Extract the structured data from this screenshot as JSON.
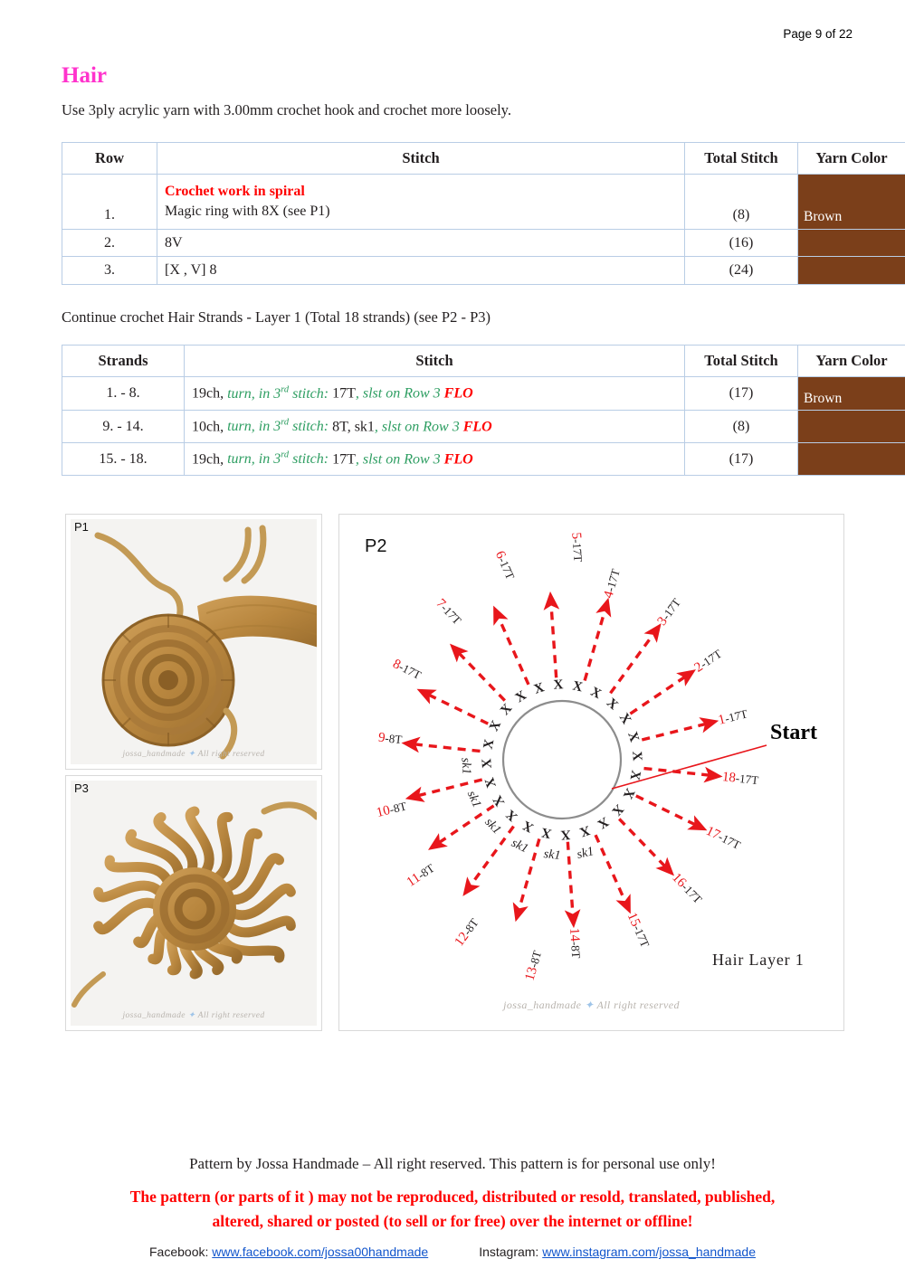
{
  "header": {
    "page_indicator": "Page 9 of 22",
    "section_title": "Hair",
    "intro": "Use 3ply acrylic yarn with 3.00mm crochet hook and crochet more loosely."
  },
  "colors": {
    "title_pink": "#ff33cc",
    "yarn_brown": "#7b3f1a",
    "accent_red": "#ff0000",
    "accent_green": "#2e9e62",
    "table_border": "#b9cde5",
    "diagram_red": "#e8161b"
  },
  "table_rows": {
    "headers": [
      "Row",
      "Stitch",
      "Total Stitch",
      "Yarn Color"
    ],
    "spiral_note": "Crochet work in spiral",
    "rows": [
      {
        "row": "1.",
        "stitch": "Magic ring with 8X (see P1)",
        "total": "(8)",
        "yarn": "Brown"
      },
      {
        "row": "2.",
        "stitch": "8V",
        "total": "(16)",
        "yarn": ""
      },
      {
        "row": "3.",
        "stitch": "[X , V] 8",
        "total": "(24)",
        "yarn": ""
      }
    ]
  },
  "mid_note": "Continue crochet Hair Strands - Layer 1 (Total 18 strands) (see P2 - P3)",
  "table_strands": {
    "headers": [
      "Strands",
      "Stitch",
      "Total Stitch",
      "Yarn Color"
    ],
    "rows": [
      {
        "strands": "1. - 8.",
        "chain": "19ch,",
        "turn": "turn, in 3",
        "turn_sup": "rd",
        "turn_tail": " stitch:",
        "count": "17T",
        "slst": ", slst on Row 3",
        "flo": "FLO",
        "extra": "",
        "total": "(17)",
        "yarn": "Brown"
      },
      {
        "strands": "9. - 14.",
        "chain": "10ch,",
        "turn": "turn, in 3",
        "turn_sup": "rd",
        "turn_tail": " stitch:",
        "count": "8T",
        "extra": ", sk1",
        "slst": ", slst on Row 3",
        "flo": "FLO",
        "total": "(8)",
        "yarn": ""
      },
      {
        "strands": "15. - 18.",
        "chain": "19ch,",
        "turn": "turn, in 3",
        "turn_sup": "rd",
        "turn_tail": " stitch:",
        "count": "17T",
        "extra": "",
        "slst": ", slst on Row 3",
        "flo": "FLO",
        "total": "(17)",
        "yarn": ""
      }
    ]
  },
  "figures": {
    "p1": {
      "tag": "P1",
      "watermark_left": "jossa_handmade",
      "watermark_right": "All right reserved"
    },
    "p3": {
      "tag": "P3",
      "watermark_left": "jossa_handmade",
      "watermark_right": "All right reserved"
    },
    "p2": {
      "tag": "P2",
      "start_label": "Start",
      "caption": "Hair Layer 1",
      "watermark_left": "jossa_handmade",
      "watermark_right": "All right reserved",
      "sk1_label": "sk1",
      "x_count": 24,
      "sk1_count": 6
    }
  },
  "diagram_data": {
    "type": "radial-chart",
    "title": "Hair Layer 1",
    "center_note": "magic-ring circle (Row 3, 24 stitches)",
    "strands": [
      {
        "index": 1,
        "num": "1",
        "suffix": "-17T",
        "stitch": "17T"
      },
      {
        "index": 2,
        "num": "2",
        "suffix": "-17T",
        "stitch": "17T"
      },
      {
        "index": 3,
        "num": "3",
        "suffix": "-17T",
        "stitch": "17T"
      },
      {
        "index": 4,
        "num": "4",
        "suffix": "-17T",
        "stitch": "17T"
      },
      {
        "index": 5,
        "num": "5",
        "suffix": "-17T",
        "stitch": "17T"
      },
      {
        "index": 6,
        "num": "6",
        "suffix": "-17T",
        "stitch": "17T"
      },
      {
        "index": 7,
        "num": "7",
        "suffix": "-17T",
        "stitch": "17T"
      },
      {
        "index": 8,
        "num": "8",
        "suffix": "-17T",
        "stitch": "17T"
      },
      {
        "index": 9,
        "num": "9",
        "suffix": "-8T",
        "stitch": "8T"
      },
      {
        "index": 10,
        "num": "10",
        "suffix": "-8T",
        "stitch": "8T"
      },
      {
        "index": 11,
        "num": "11",
        "suffix": "-8T",
        "stitch": "8T"
      },
      {
        "index": 12,
        "num": "12",
        "suffix": "-8T",
        "stitch": "8T"
      },
      {
        "index": 13,
        "num": "13",
        "suffix": "-8T",
        "stitch": "8T"
      },
      {
        "index": 14,
        "num": "14",
        "suffix": "-8T",
        "stitch": "8T"
      },
      {
        "index": 15,
        "num": "15",
        "suffix": "-17T",
        "stitch": "17T"
      },
      {
        "index": 16,
        "num": "16",
        "suffix": "-17T",
        "stitch": "17T"
      },
      {
        "index": 17,
        "num": "17",
        "suffix": "-17T",
        "stitch": "17T"
      },
      {
        "index": 18,
        "num": "18",
        "suffix": "-17T",
        "stitch": "17T"
      }
    ]
  },
  "footer": {
    "line1": "Pattern by Jossa Handmade – All right reserved. This pattern is for personal use only!",
    "line2a": "The pattern (or parts of it ) may not be reproduced, distributed or resold, translated, published,",
    "line2b": "altered, shared or posted (to sell or for free) over the internet or offline!",
    "facebook_label": "Facebook:",
    "facebook_url": "www.facebook.com/jossa00handmade",
    "instagram_label": "Instagram:",
    "instagram_url": "www.instagram.com/jossa_handmade"
  }
}
